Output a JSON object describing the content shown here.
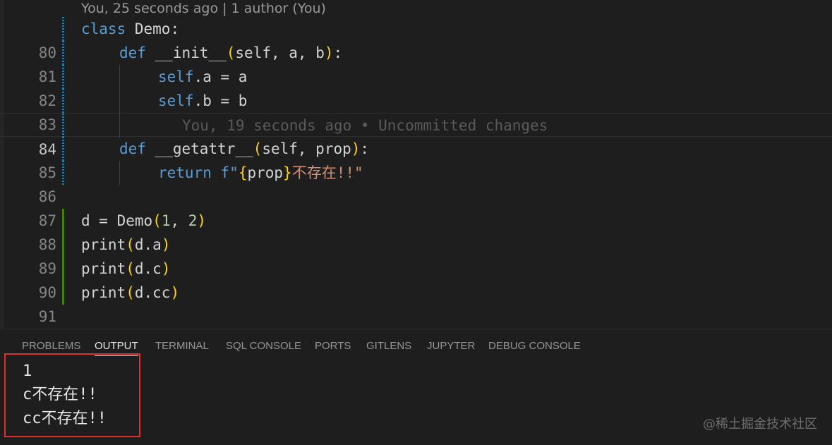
{
  "editor": {
    "codelens": "You, 25 seconds ago | 1 author (You)",
    "blame_line": "You, 19 seconds ago • Uncommitted changes",
    "lines": [
      {
        "num": "80"
      },
      {
        "num": "81"
      },
      {
        "num": "82"
      },
      {
        "num": "83"
      },
      {
        "num": "84"
      },
      {
        "num": "85"
      },
      {
        "num": "86"
      },
      {
        "num": "87"
      },
      {
        "num": "88"
      },
      {
        "num": "89"
      },
      {
        "num": "90"
      },
      {
        "num": "91"
      }
    ],
    "tokens": {
      "class_kw": "class",
      "class_name": "Demo",
      "colon": ":",
      "def_kw": "def",
      "init_name": "__init__",
      "open_paren": "(",
      "close_paren": ")",
      "init_params": "self, a, b",
      "self_kw": "self",
      "attr_a": ".a = a",
      "attr_b": ".b = b",
      "getattr_name": "__getattr__",
      "getattr_params": "self, prop",
      "return_kw": "return",
      "fstring_prefix": "f\"",
      "brace_open": "{",
      "brace_close": "}",
      "fstring_var": "prop",
      "fstring_text": "不存在!!\"",
      "assign": "d = Demo",
      "arg1": "1",
      "comma": ", ",
      "arg2": "2",
      "print_fn": "print",
      "arg_da": "d.a",
      "arg_dc": "d.c",
      "arg_dcc": "d.cc"
    }
  },
  "panel": {
    "tabs": [
      {
        "label": "PROBLEMS"
      },
      {
        "label": "OUTPUT"
      },
      {
        "label": "TERMINAL"
      },
      {
        "label": "SQL CONSOLE"
      },
      {
        "label": "PORTS"
      },
      {
        "label": "GITLENS"
      },
      {
        "label": "JUPYTER"
      },
      {
        "label": "DEBUG CONSOLE"
      }
    ],
    "active_tab": "OUTPUT",
    "output_lines": [
      "1",
      "c不存在!!",
      "cc不存在!!"
    ]
  },
  "watermark": "@稀土掘金技术社区",
  "colors": {
    "background": "#1e1e1e",
    "keyword": "#569cd6",
    "string": "#ce9178",
    "number": "#b5cea8",
    "bracket": "#ffd700",
    "highlight_box": "#d9332c",
    "gutter_added": "#487e02",
    "gutter_modified": "#1b81a8"
  }
}
